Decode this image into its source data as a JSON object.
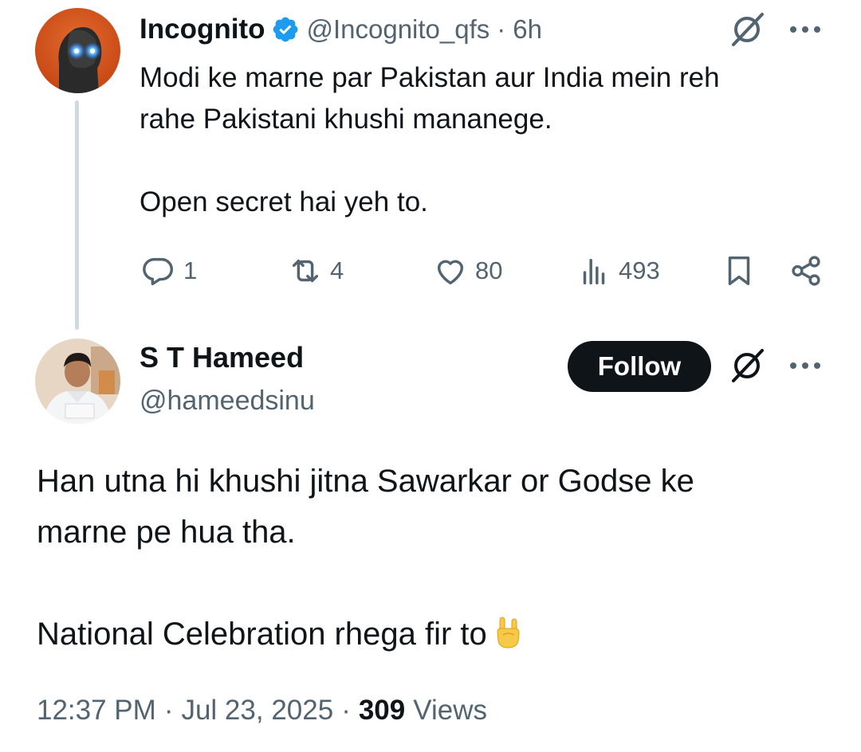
{
  "parent_tweet": {
    "author_name": "Incognito",
    "handle": "@Incognito_qfs",
    "separator": "·",
    "time": "6h",
    "text_lines": [
      "Modi ke marne par Pakistan aur India mein reh",
      "rahe Pakistani khushi mananege.",
      "Open secret hai yeh to."
    ],
    "actions": {
      "replies": "1",
      "reposts": "4",
      "likes": "80",
      "views": "493"
    }
  },
  "reply_tweet": {
    "author_name": "S T Hameed",
    "handle": "@hameedsinu",
    "follow_label": "Follow",
    "text_lines": [
      "Han utna hi khushi jitna Sawarkar or Godse ke",
      "marne pe hua tha.",
      "National Celebration rhega fir to"
    ],
    "emoji": "rock-on-hand-emoji",
    "time": "12:37 PM",
    "separator": "·",
    "date": "Jul 23, 2025",
    "views_count": "309",
    "views_label": "Views"
  },
  "colors": {
    "text_primary": "#0f1419",
    "text_secondary": "#536471",
    "verified_blue": "#1d9bf0",
    "thread_line": "#cfd9de",
    "follow_bg": "#0f1419"
  }
}
